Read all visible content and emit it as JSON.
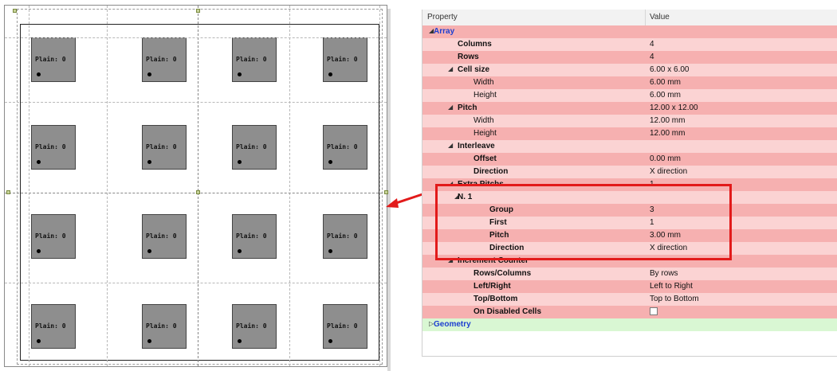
{
  "canvas": {
    "cell_label": "Plain: 0",
    "cells": [
      {
        "label": "Plain: 0"
      },
      {
        "label": "Plain: 0"
      },
      {
        "label": "Plain: 0"
      },
      {
        "label": "Plain: 0"
      },
      {
        "label": "Plain: 0"
      },
      {
        "label": "Plain: 0"
      },
      {
        "label": "Plain: 0"
      },
      {
        "label": "Plain: 0"
      },
      {
        "label": "Plain: 0"
      },
      {
        "label": "Plain: 0"
      },
      {
        "label": "Plain: 0"
      },
      {
        "label": "Plain: 0"
      },
      {
        "label": "Plain: 0"
      },
      {
        "label": "Plain: 0"
      },
      {
        "label": "Plain: 0"
      },
      {
        "label": "Plain: 0"
      }
    ]
  },
  "grid": {
    "header": {
      "property": "Property",
      "value": "Value"
    },
    "rows": [
      {
        "name": "Array",
        "value": "",
        "level": 0,
        "expander": "expanded",
        "style": "blue"
      },
      {
        "name": "Columns",
        "value": "4",
        "level": 2,
        "style": "bold"
      },
      {
        "name": "Rows",
        "value": "4",
        "level": 2,
        "style": "bold"
      },
      {
        "name": "Cell size",
        "value": "6.00 x 6.00",
        "level": 1,
        "expander": "expanded",
        "style": "bold"
      },
      {
        "name": "Width",
        "value": "6.00 mm",
        "level": 3,
        "style": "normal"
      },
      {
        "name": "Height",
        "value": "6.00 mm",
        "level": 3,
        "style": "normal"
      },
      {
        "name": "Pitch",
        "value": "12.00 x 12.00",
        "level": 1,
        "expander": "expanded",
        "style": "bold"
      },
      {
        "name": "Width",
        "value": "12.00 mm",
        "level": 3,
        "style": "normal"
      },
      {
        "name": "Height",
        "value": "12.00 mm",
        "level": 3,
        "style": "normal"
      },
      {
        "name": "Interleave",
        "value": "",
        "level": 1,
        "expander": "expanded",
        "style": "bold"
      },
      {
        "name": "Offset",
        "value": "0.00 mm",
        "level": 3,
        "style": "bold"
      },
      {
        "name": "Direction",
        "value": "X direction",
        "level": 3,
        "style": "bold"
      },
      {
        "name": "Extra Pitchs",
        "value": "1",
        "level": 1,
        "expander": "expanded",
        "style": "bold"
      },
      {
        "name": "N. 1",
        "value": "",
        "level": 2,
        "expander": "expanded",
        "style": "bold"
      },
      {
        "name": "Group",
        "value": "3",
        "level": 4,
        "style": "bold"
      },
      {
        "name": "First",
        "value": "1",
        "level": 4,
        "style": "bold"
      },
      {
        "name": "Pitch",
        "value": "3.00 mm",
        "level": 4,
        "style": "bold"
      },
      {
        "name": "Direction",
        "value": "X direction",
        "level": 4,
        "style": "bold"
      },
      {
        "name": "Increment Counter",
        "value": "",
        "level": 1,
        "expander": "expanded",
        "style": "bold"
      },
      {
        "name": "Rows/Columns",
        "value": "By rows",
        "level": 3,
        "style": "bold"
      },
      {
        "name": "Left/Right",
        "value": "Left to Right",
        "level": 3,
        "style": "bold"
      },
      {
        "name": "Top/Bottom",
        "value": "Top to Bottom",
        "level": 3,
        "style": "bold"
      },
      {
        "name": "On Disabled Cells",
        "value": "",
        "level": 3,
        "style": "bold",
        "checkbox": true,
        "checked": false
      },
      {
        "name": "Geometry",
        "value": "",
        "level": 0,
        "expander": "collapsed",
        "style": "blue",
        "category": "geometry"
      }
    ]
  },
  "colors": {
    "row_pink_light": "#fbd3d3",
    "row_pink_dark": "#f6b0b0",
    "geometry_green": "#d9f7d3",
    "highlight_red": "#e21a1a",
    "category_blue": "#1d3fd1"
  },
  "icons": {
    "expanded": "triangle-expanded-icon",
    "collapsed": "triangle-collapsed-icon"
  }
}
